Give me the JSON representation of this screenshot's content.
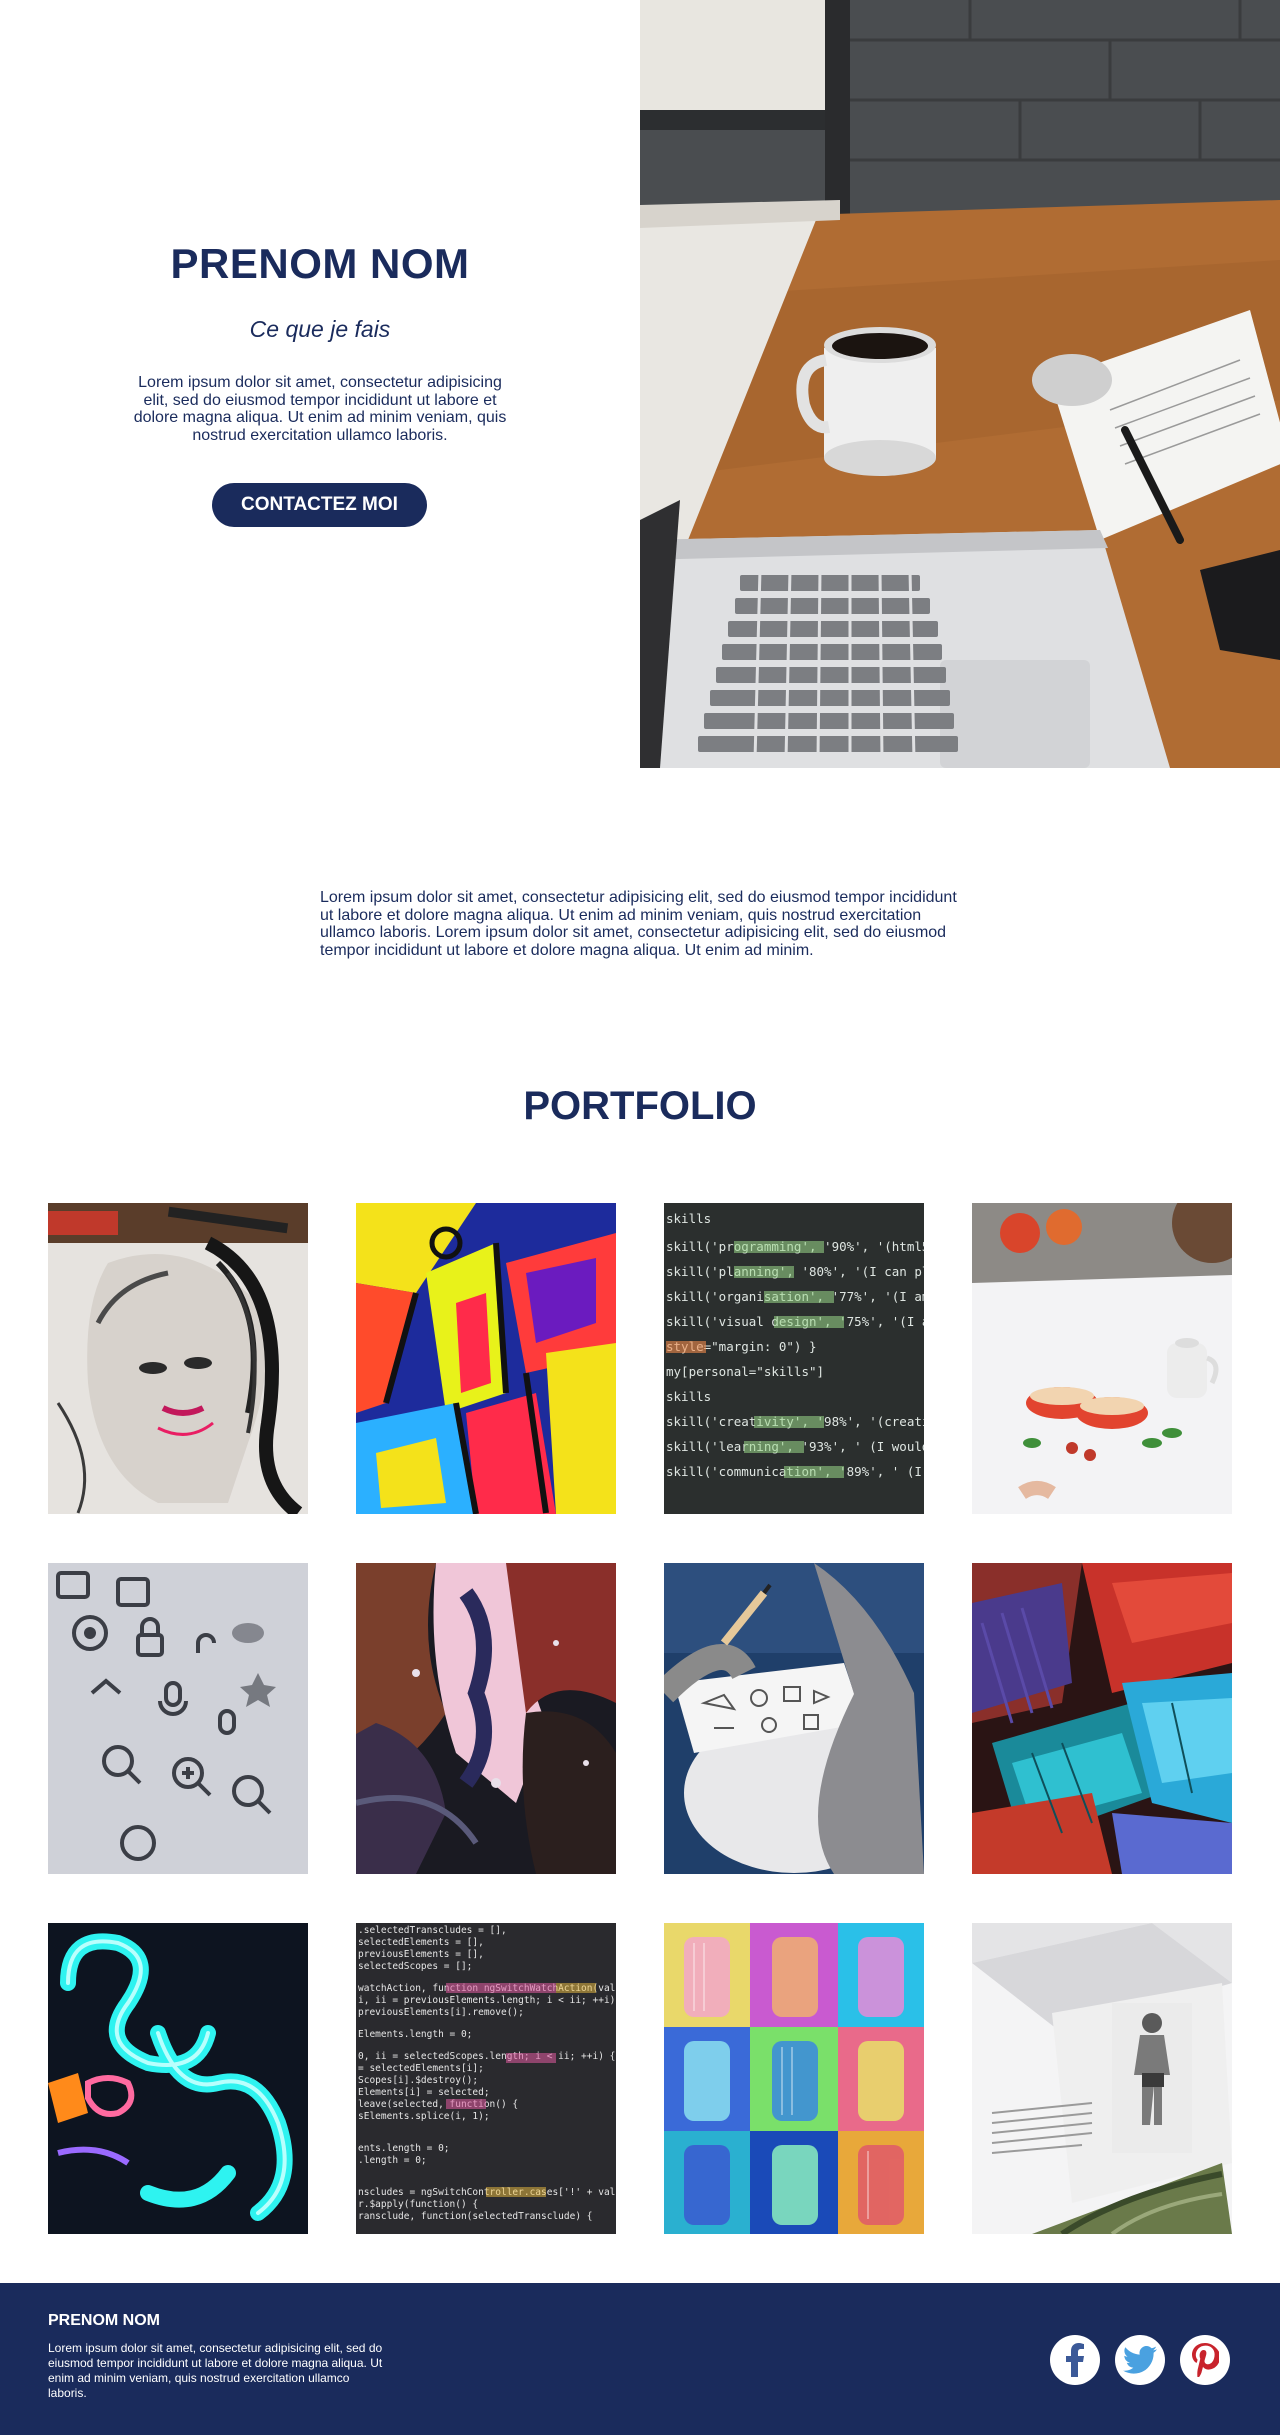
{
  "hero": {
    "name": "PRENOM NOM",
    "tagline": "Ce que je fais",
    "description": "Lorem ipsum dolor sit amet, consectetur adipisicing elit, sed do eiusmod tempor incididunt ut labore et dolore magna aliqua. Ut enim ad minim veniam, quis nostrud exercitation ullamco laboris.",
    "contact_button": "CONTACTEZ MOI"
  },
  "intro": {
    "text": "Lorem ipsum dolor sit amet, consectetur adipisicing elit, sed do eiusmod tempor incididunt ut labore et dolore magna aliqua. Ut enim ad minim veniam, quis nostrud exercitation ullamco laboris. Lorem ipsum dolor sit amet, consectetur adipisicing elit, sed do eiusmod tempor incididunt ut labore et dolore magna aliqua. Ut enim ad minim."
  },
  "portfolio": {
    "title": "PORTFOLIO"
  },
  "footer": {
    "name": "PRENOM NOM",
    "description": "Lorem ipsum dolor sit amet, consectetur adipisicing elit, sed do eiusmod tempor incididunt ut labore et dolore magna aliqua. Ut enim ad minim veniam, quis nostrud exercitation ullamco laboris.",
    "social": [
      "facebook-icon",
      "twitter-icon",
      "pinterest-icon"
    ]
  },
  "colors": {
    "primary": "#1a2b5c",
    "facebook": "#3b5998",
    "twitter": "#4aa1e0",
    "pinterest": "#c8232c"
  }
}
